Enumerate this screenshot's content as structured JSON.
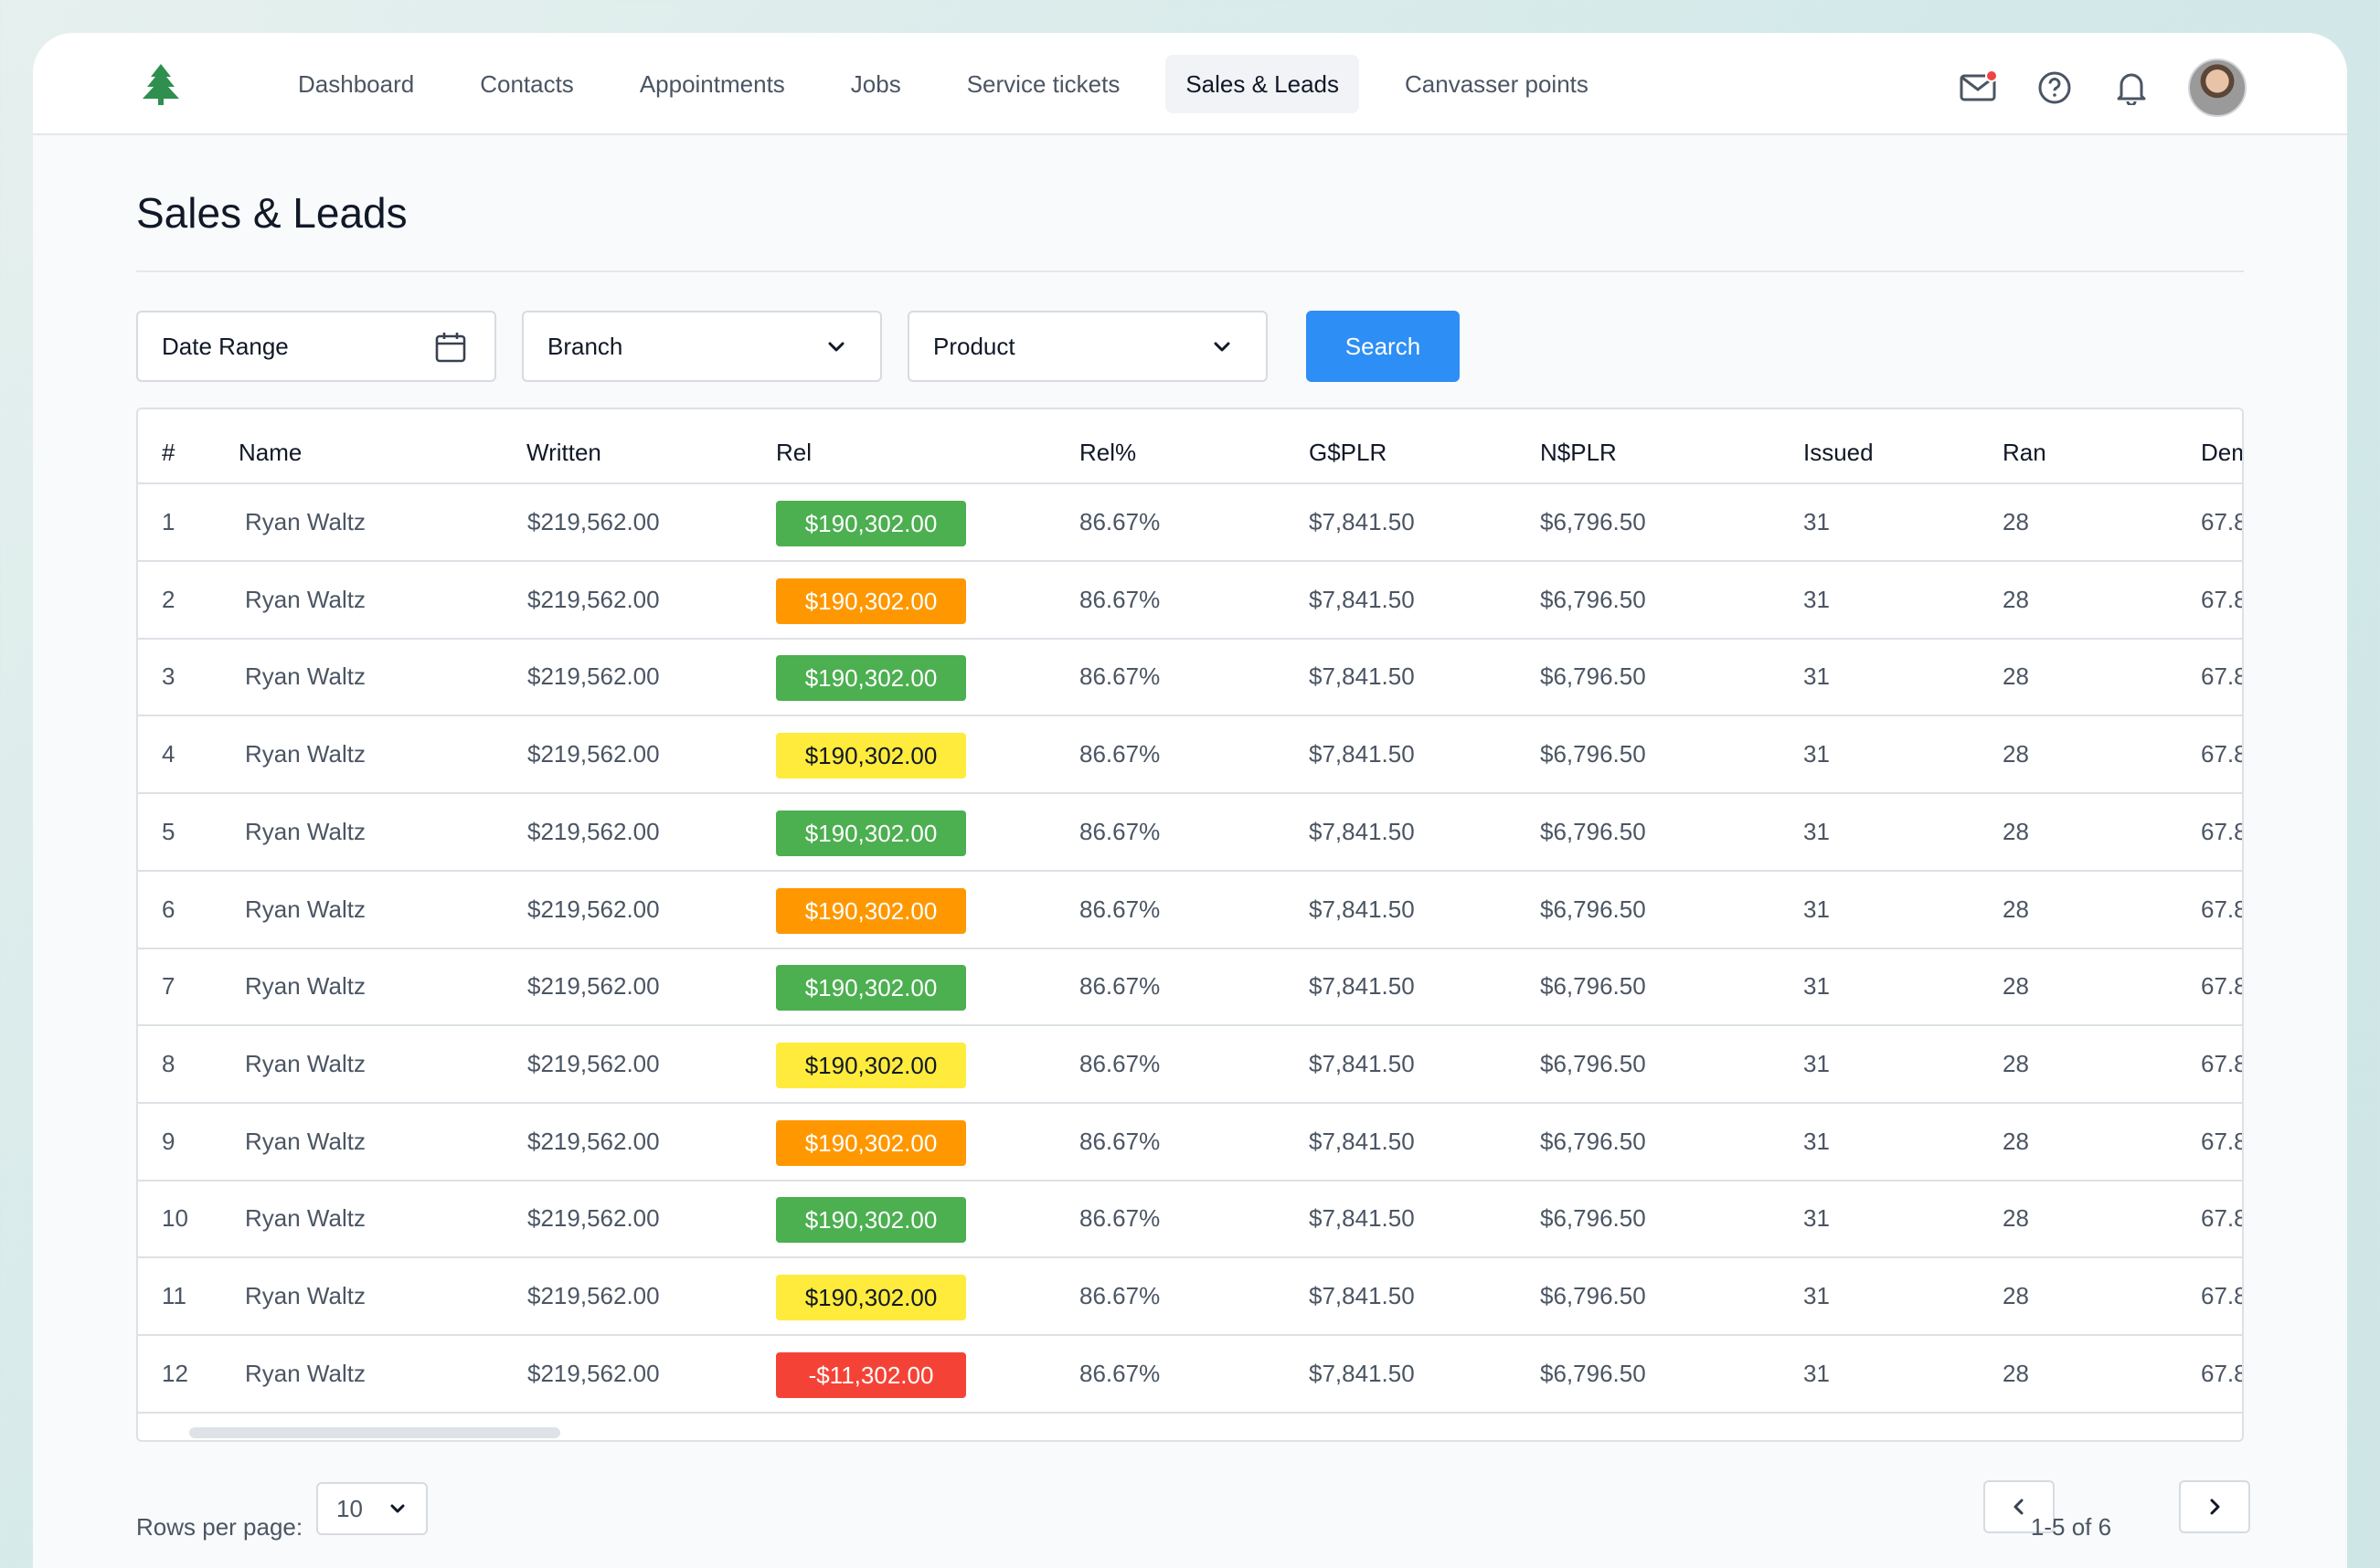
{
  "nav": {
    "items": [
      {
        "label": "Dashboard"
      },
      {
        "label": "Contacts"
      },
      {
        "label": "Appointments"
      },
      {
        "label": "Jobs"
      },
      {
        "label": "Service tickets"
      },
      {
        "label": "Sales & Leads",
        "active": true
      },
      {
        "label": "Canvasser points"
      }
    ],
    "icons": [
      "mail-icon",
      "help-icon",
      "bell-icon",
      "avatar"
    ]
  },
  "page": {
    "title": "Sales & Leads"
  },
  "filters": {
    "date_range": "Date Range",
    "branch": "Branch",
    "product": "Product",
    "search_label": "Search"
  },
  "table": {
    "columns": [
      "#",
      "Name",
      "Written",
      "Rel",
      "Rel%",
      "G$PLR",
      "N$PLR",
      "Issued",
      "Ran",
      "Dem"
    ],
    "rows": [
      {
        "n": "1",
        "name": "Ryan Waltz",
        "written": "$219,562.00",
        "rel": "$190,302.00",
        "rel_status": "green",
        "rel_pct": "86.67%",
        "gplr": "$7,841.50",
        "nplr": "$6,796.50",
        "issued": "31",
        "ran": "28",
        "dem": "67.8"
      },
      {
        "n": "2",
        "name": "Ryan Waltz",
        "written": "$219,562.00",
        "rel": "$190,302.00",
        "rel_status": "orange",
        "rel_pct": "86.67%",
        "gplr": "$7,841.50",
        "nplr": "$6,796.50",
        "issued": "31",
        "ran": "28",
        "dem": "67.8"
      },
      {
        "n": "3",
        "name": "Ryan Waltz",
        "written": "$219,562.00",
        "rel": "$190,302.00",
        "rel_status": "green",
        "rel_pct": "86.67%",
        "gplr": "$7,841.50",
        "nplr": "$6,796.50",
        "issued": "31",
        "ran": "28",
        "dem": "67.8"
      },
      {
        "n": "4",
        "name": "Ryan Waltz",
        "written": "$219,562.00",
        "rel": "$190,302.00",
        "rel_status": "yellow",
        "rel_pct": "86.67%",
        "gplr": "$7,841.50",
        "nplr": "$6,796.50",
        "issued": "31",
        "ran": "28",
        "dem": "67.8"
      },
      {
        "n": "5",
        "name": "Ryan Waltz",
        "written": "$219,562.00",
        "rel": "$190,302.00",
        "rel_status": "green",
        "rel_pct": "86.67%",
        "gplr": "$7,841.50",
        "nplr": "$6,796.50",
        "issued": "31",
        "ran": "28",
        "dem": "67.8"
      },
      {
        "n": "6",
        "name": "Ryan Waltz",
        "written": "$219,562.00",
        "rel": "$190,302.00",
        "rel_status": "orange",
        "rel_pct": "86.67%",
        "gplr": "$7,841.50",
        "nplr": "$6,796.50",
        "issued": "31",
        "ran": "28",
        "dem": "67.8"
      },
      {
        "n": "7",
        "name": "Ryan Waltz",
        "written": "$219,562.00",
        "rel": "$190,302.00",
        "rel_status": "green",
        "rel_pct": "86.67%",
        "gplr": "$7,841.50",
        "nplr": "$6,796.50",
        "issued": "31",
        "ran": "28",
        "dem": "67.8"
      },
      {
        "n": "8",
        "name": "Ryan Waltz",
        "written": "$219,562.00",
        "rel": "$190,302.00",
        "rel_status": "yellow",
        "rel_pct": "86.67%",
        "gplr": "$7,841.50",
        "nplr": "$6,796.50",
        "issued": "31",
        "ran": "28",
        "dem": "67.8"
      },
      {
        "n": "9",
        "name": "Ryan Waltz",
        "written": "$219,562.00",
        "rel": "$190,302.00",
        "rel_status": "orange",
        "rel_pct": "86.67%",
        "gplr": "$7,841.50",
        "nplr": "$6,796.50",
        "issued": "31",
        "ran": "28",
        "dem": "67.8"
      },
      {
        "n": "10",
        "name": "Ryan Waltz",
        "written": "$219,562.00",
        "rel": "$190,302.00",
        "rel_status": "green",
        "rel_pct": "86.67%",
        "gplr": "$7,841.50",
        "nplr": "$6,796.50",
        "issued": "31",
        "ran": "28",
        "dem": "67.8"
      },
      {
        "n": "11",
        "name": "Ryan Waltz",
        "written": "$219,562.00",
        "rel": "$190,302.00",
        "rel_status": "yellow",
        "rel_pct": "86.67%",
        "gplr": "$7,841.50",
        "nplr": "$6,796.50",
        "issued": "31",
        "ran": "28",
        "dem": "67.8"
      },
      {
        "n": "12",
        "name": "Ryan Waltz",
        "written": "$219,562.00",
        "rel": "-$11,302.00",
        "rel_status": "red",
        "rel_pct": "86.67%",
        "gplr": "$7,841.50",
        "nplr": "$6,796.50",
        "issued": "31",
        "ran": "28",
        "dem": "67.8"
      }
    ]
  },
  "status_colors": {
    "green": "#4caf50",
    "orange": "#ff9800",
    "yellow": "#ffeb3b",
    "red": "#f44336"
  },
  "pagination": {
    "rows_per_page_label": "Rows per page:",
    "rows_per_page_value": "10",
    "range_text": "1-5 of 6"
  },
  "colors": {
    "accent": "#2d8ef5",
    "logo": "#2f8f4e"
  }
}
